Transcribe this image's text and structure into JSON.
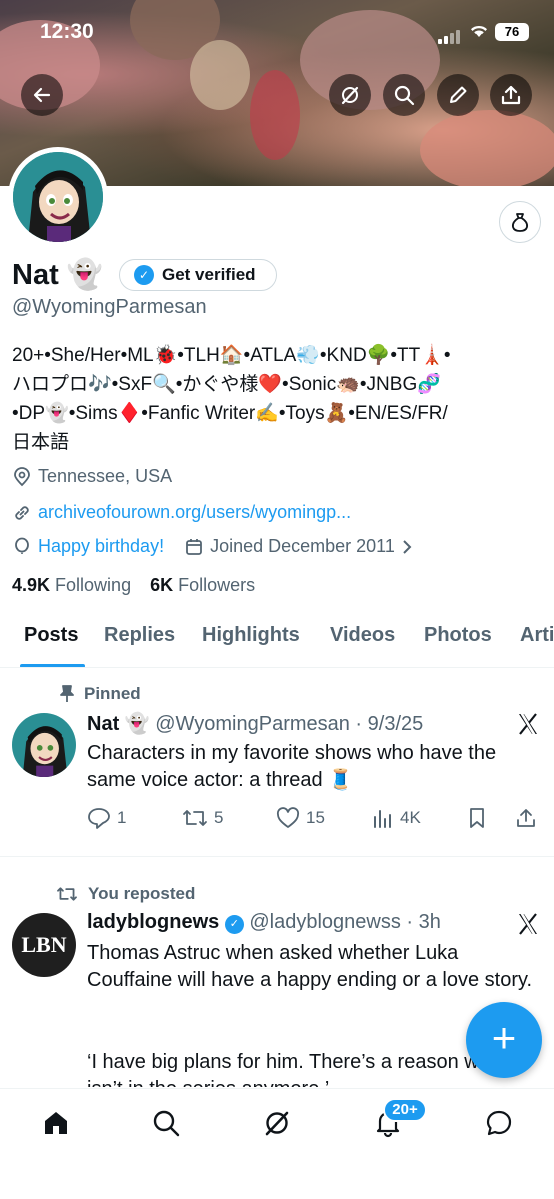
{
  "status_bar": {
    "time": "12:30",
    "battery": "76"
  },
  "profile": {
    "name": "Nat 👻",
    "get_verified": "Get verified",
    "handle": "@WyomingParmesan",
    "bio_lines": [
      "20+•She/Her•ML🐞•TLH🏠•ATLA💨•KND🌳•TT🗼•",
      "ハロプロ🎶•SxF🔍•かぐや様❤️•Sonic🦔•JNBG🧬",
      "•DP👻•Sims♦️•Fanfic Writer✍️•Toys🧸•EN/ES/FR/",
      "日本語"
    ],
    "location": "Tennessee, USA",
    "link": "archiveofourown.org/users/wyomingp...",
    "birthday": "Happy birthday!",
    "joined": "Joined December 2011",
    "following_count": "4.9K",
    "following_label": "Following",
    "followers_count": "6K",
    "followers_label": "Followers"
  },
  "tabs": [
    "Posts",
    "Replies",
    "Highlights",
    "Videos",
    "Photos",
    "Arti"
  ],
  "posts": [
    {
      "context": "Pinned",
      "name": "Nat 👻",
      "handle": "@WyomingParmesan · 9/3/25",
      "text": "Characters in my favorite shows who have the same voice actor: a thread 🧵",
      "replies": "1",
      "reposts": "5",
      "likes": "15",
      "views": "4K"
    },
    {
      "context": "You reposted",
      "avatar_text": "LBN",
      "name": "ladyblognews",
      "handle": "@ladyblognewss · 3h",
      "text1": "Thomas Astruc when asked whether Luka Couffaine will have a happy ending or a love story.",
      "text2": "‘I have big plans for him. There’s a reason why he isn’t in the series anymore.’"
    }
  ],
  "fab": "+",
  "notifications_badge": "20+",
  "colors": {
    "accent": "#1d9bf0",
    "text": "#0f1419",
    "secondary": "#536471"
  }
}
